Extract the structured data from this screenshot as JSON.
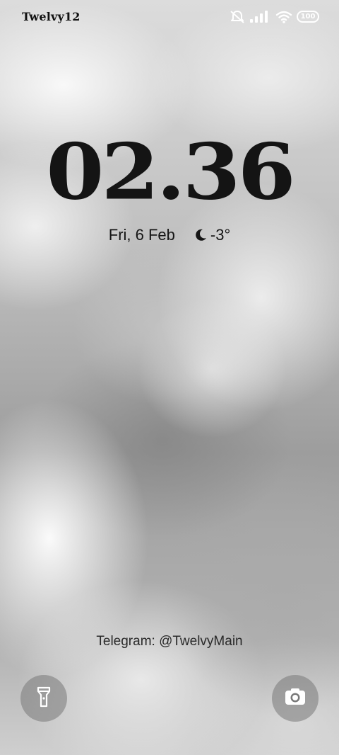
{
  "status_bar": {
    "carrier": "Twelvy12",
    "battery_level": "100",
    "icons": [
      "notifications-off-icon",
      "signal-icon",
      "wifi-icon",
      "battery-icon"
    ]
  },
  "lock_screen": {
    "time": "02.36",
    "date": "Fri, 6 Feb",
    "weather_icon": "moon-icon",
    "temperature": "-3°",
    "footer_text": "Telegram: @TwelvyMain"
  },
  "shortcuts": {
    "left": "flashlight-icon",
    "right": "camera-icon"
  },
  "colors": {
    "clock": "#141414",
    "status_icons": "#ffffff",
    "shortcut_bg": "#787878"
  }
}
